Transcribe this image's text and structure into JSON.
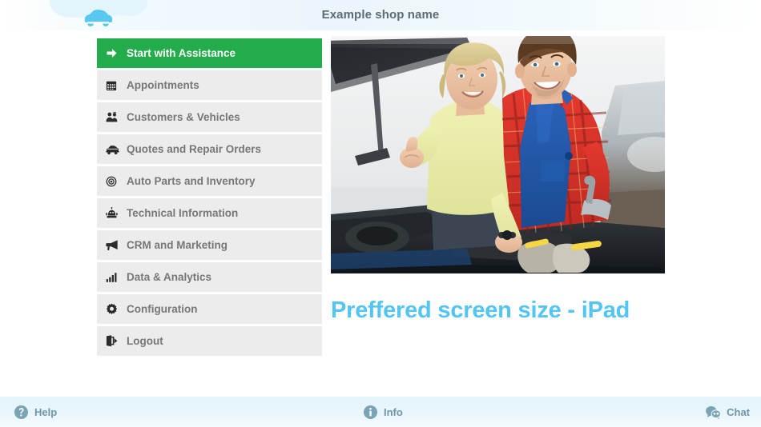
{
  "header": {
    "title": "Example shop name",
    "logo_icon": "car-icon",
    "background_color": "#e8f6fc",
    "title_color": "#5e6a74"
  },
  "sidebar": {
    "active_color": "#22ac4b",
    "item_color": "#ececec",
    "items": [
      {
        "label": "Start with Assistance",
        "icon": "arrow-right-icon",
        "active": true
      },
      {
        "label": "Appointments",
        "icon": "calendar-icon",
        "active": false
      },
      {
        "label": "Customers & Vehicles",
        "icon": "users-icon",
        "active": false
      },
      {
        "label": "Quotes and Repair Orders",
        "icon": "car-side-icon",
        "active": false
      },
      {
        "label": "Auto Parts and Inventory",
        "icon": "disc-icon",
        "active": false
      },
      {
        "label": "Technical Information",
        "icon": "robot-icon",
        "active": false
      },
      {
        "label": "CRM and Marketing",
        "icon": "bullhorn-icon",
        "active": false
      },
      {
        "label": "Data & Analytics",
        "icon": "bar-chart-icon",
        "active": false
      },
      {
        "label": "Configuration",
        "icon": "gear-icon",
        "active": false
      },
      {
        "label": "Logout",
        "icon": "sign-out-icon",
        "active": false
      }
    ]
  },
  "main": {
    "photo_alt": "Mechanic in blue overalls and red plaid shirt with a smiling female customer giving a thumbs up in front of an open car hood",
    "tagline": "Preffered screen size - iPad",
    "tagline_color": "#52c5f0"
  },
  "footer": {
    "background_color": "#e8f6fc",
    "text_color": "#6f96a8",
    "items": [
      {
        "label": "Help",
        "icon": "question-circle-icon"
      },
      {
        "label": "Info",
        "icon": "info-circle-icon"
      },
      {
        "label": "Chat",
        "icon": "chat-bubbles-icon"
      }
    ]
  }
}
